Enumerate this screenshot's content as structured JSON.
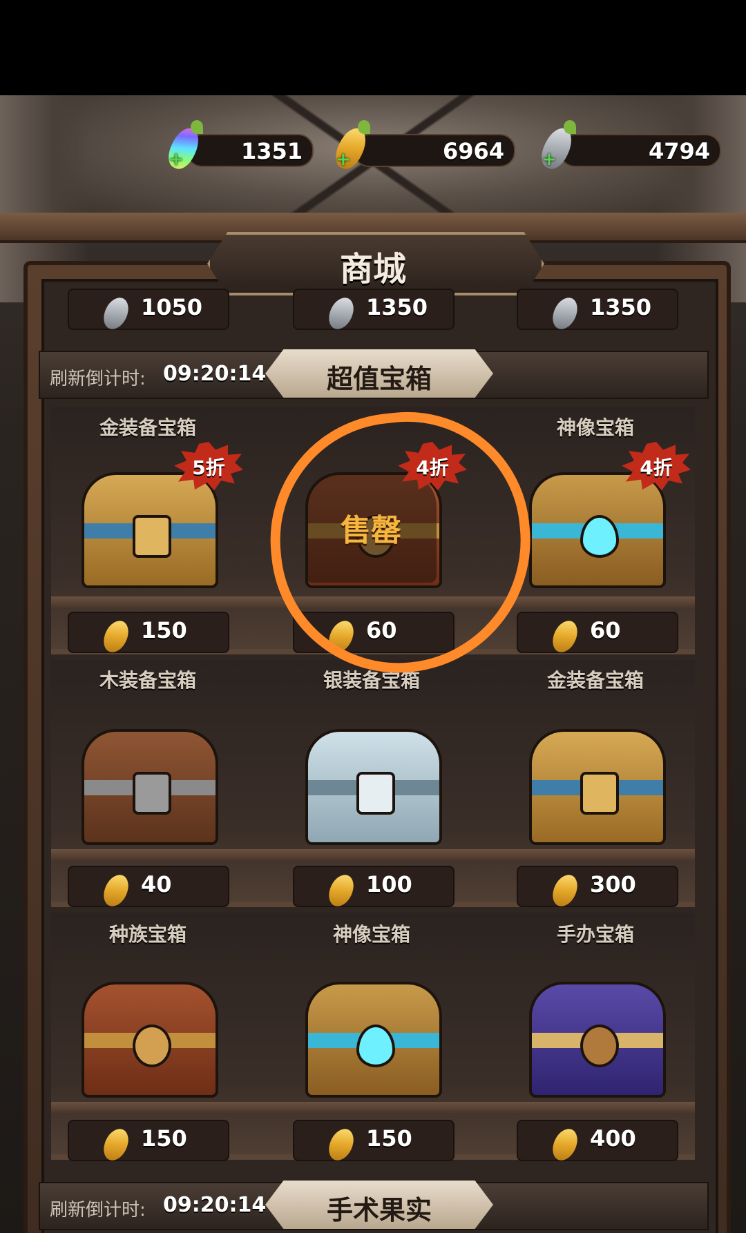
{
  "currencies": [
    {
      "name": "rainbow-carrot",
      "value": "1351"
    },
    {
      "name": "gold-carrot",
      "value": "6964"
    },
    {
      "name": "silver-carrot",
      "value": "4794"
    }
  ],
  "title": "商城",
  "top_prices": [
    "1050",
    "1350",
    "1350"
  ],
  "sections": [
    {
      "refresh_label": "刷新倒计时:",
      "refresh_time": "09:20:14",
      "header": "超值宝箱"
    },
    {
      "refresh_label": "刷新倒计时:",
      "refresh_time": "09:20:14",
      "header": "手术果实"
    }
  ],
  "rows": [
    [
      {
        "name": "金装备宝箱",
        "price": "150",
        "discount": "5折"
      },
      {
        "name": "",
        "price": "60",
        "discount": "4折",
        "status": "售罄"
      },
      {
        "name": "神像宝箱",
        "price": "60",
        "discount": "4折"
      }
    ],
    [
      {
        "name": "木装备宝箱",
        "price": "40"
      },
      {
        "name": "银装备宝箱",
        "price": "100"
      },
      {
        "name": "金装备宝箱",
        "price": "300"
      }
    ],
    [
      {
        "name": "种族宝箱",
        "price": "150"
      },
      {
        "name": "神像宝箱",
        "price": "150"
      },
      {
        "name": "手办宝箱",
        "price": "400"
      }
    ]
  ],
  "colors": {
    "annotation_circle": "#ff8a2a",
    "sold_out": "#f6b640",
    "discount_badge": "#c22a1a"
  }
}
